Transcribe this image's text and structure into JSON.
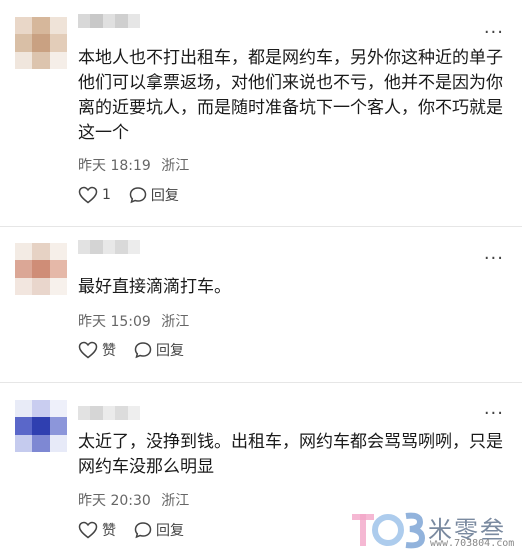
{
  "comments": [
    {
      "text": "本地人也不打出租车，都是网约车，另外你这种近的单子他们可以拿票返场，对他们来说也不亏，他并不是因为你离的近要坑人，而是随时准备坑下一个客人，你不巧就是这一个",
      "time": "昨天 18:19",
      "location": "浙江",
      "like_label": "1",
      "reply_label": "回复"
    },
    {
      "text": "最好直接滴滴打车。",
      "time": "昨天 15:09",
      "location": "浙江",
      "like_label": "赞",
      "reply_label": "回复"
    },
    {
      "text": "太近了，没挣到钱。出租车，网约车都会骂骂咧咧，只是网约车没那么明显",
      "time": "昨天 20:30",
      "location": "浙江",
      "like_label": "赞",
      "reply_label": "回复"
    }
  ],
  "more_label": "···",
  "watermark": {
    "title": "米零叁",
    "url": "www.703804.com"
  }
}
